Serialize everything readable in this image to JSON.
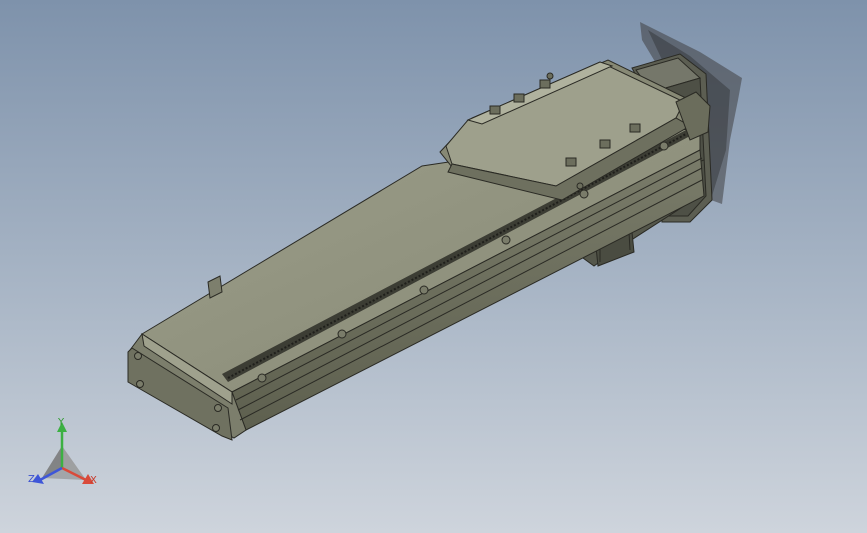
{
  "viewport": {
    "background_top": "#7e92ab",
    "background_bottom": "#ced4dc"
  },
  "model": {
    "body_color": "#8a8c78",
    "edge_color": "#2a2a24",
    "motor_color": "#5c5e52"
  },
  "triad": {
    "x_label": "X",
    "y_label": "Y",
    "z_label": "Z",
    "x_color": "#d94a3a",
    "y_color": "#3cb043",
    "z_color": "#3e56d8"
  }
}
